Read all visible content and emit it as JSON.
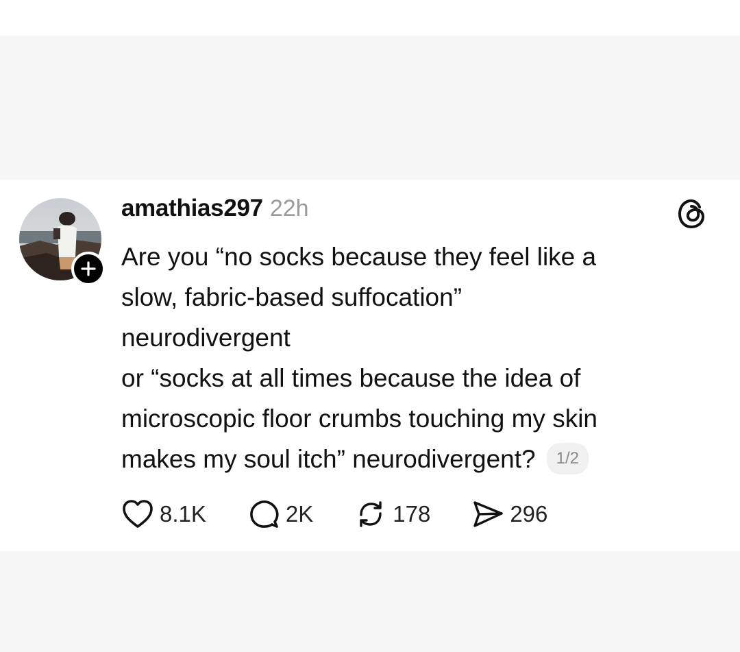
{
  "post": {
    "username": "amathias297",
    "timestamp": "22h",
    "body_lines": [
      "Are you “no socks because they feel like a",
      "slow, fabric-based suffocation”",
      "neurodivergent",
      "or “socks at all times because the idea of",
      "microscopic floor crumbs touching my skin",
      "makes my soul itch” neurodivergent?"
    ],
    "page_indicator": "1/2",
    "avatar_icon": "profile-photo",
    "follow_icon": "plus-icon",
    "app_logo_icon": "threads-logo-icon"
  },
  "actions": {
    "like": {
      "icon": "heart-icon",
      "count": "8.1K"
    },
    "reply": {
      "icon": "comment-icon",
      "count": "2K"
    },
    "repost": {
      "icon": "repost-icon",
      "count": "178"
    },
    "share": {
      "icon": "send-icon",
      "count": "296"
    }
  }
}
